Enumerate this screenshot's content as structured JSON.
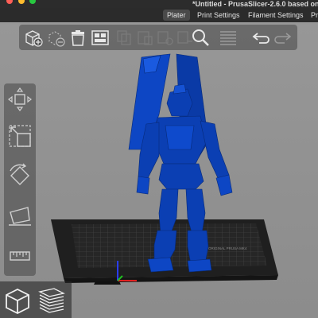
{
  "window": {
    "title": "*Untitled - PrusaSlicer-2.6.0 based on S",
    "traffic_lights": [
      "#ff5f57",
      "#febc2e",
      "#28c840"
    ]
  },
  "tabs": [
    {
      "label": "Plater",
      "active": true
    },
    {
      "label": "Print Settings",
      "active": false
    },
    {
      "label": "Filament Settings",
      "active": false
    },
    {
      "label": "Pr",
      "active": false
    }
  ],
  "toolbar": {
    "icons": [
      "add-icon",
      "delete-icon",
      "delete-all-icon",
      "arrange-icon",
      "copy-icon",
      "paste-icon",
      "add-instance-icon",
      "remove-instance-icon",
      "split-objects-icon",
      "split-parts-icon",
      "search-icon",
      "layers-icon",
      "undo-icon",
      "redo-icon"
    ]
  },
  "sidebar": {
    "icons": [
      "move-icon",
      "scale-icon",
      "rotate-icon",
      "place-on-face-icon",
      "cut-icon"
    ]
  },
  "bed": {
    "label": "ORIGINAL PRUSA MK4",
    "color": "#222222"
  },
  "model": {
    "color": "#0b3fb3"
  },
  "view_buttons": [
    "3d-view-icon",
    "preview-icon"
  ]
}
